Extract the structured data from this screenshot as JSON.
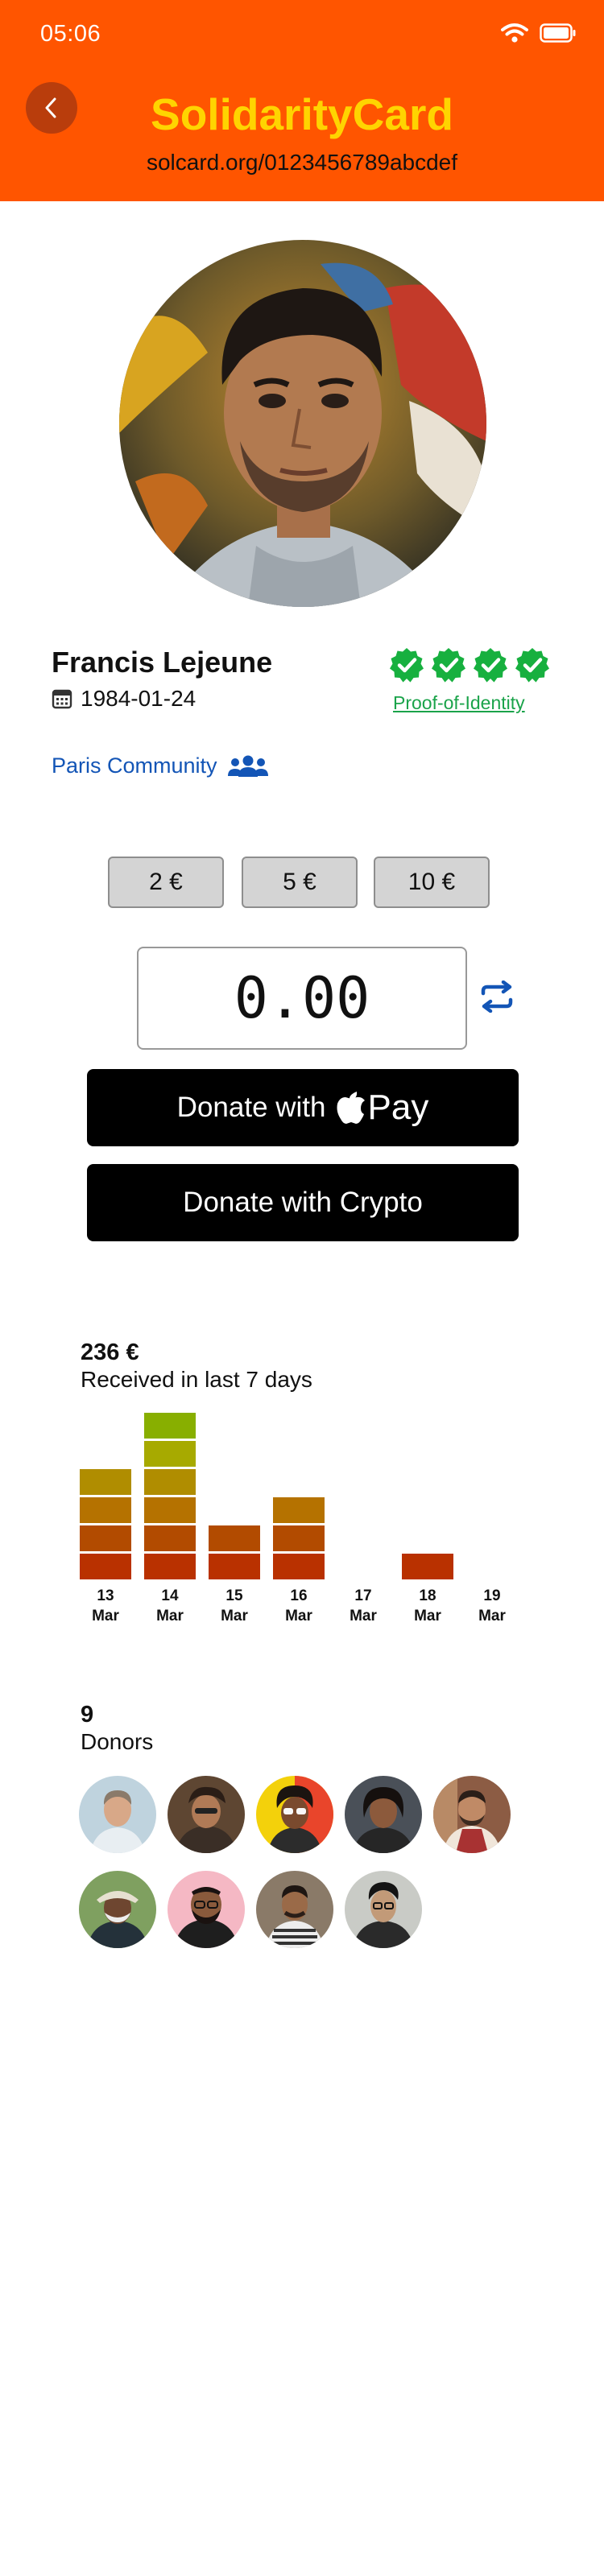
{
  "status_bar": {
    "time": "05:06",
    "wifi_icon": "wifi-icon",
    "battery_icon": "battery-icon"
  },
  "header": {
    "title": "SolidarityCard",
    "url": "solcard.org/0123456789abcdef",
    "background": "#FF5500",
    "title_color": "#FFD400",
    "back_icon": "chevron-left-icon"
  },
  "profile": {
    "name": "Francis Lejeune",
    "dob": "1984-01-24",
    "proof_label": "Proof-of-Identity",
    "verified_badges": 4,
    "community": "Paris Community"
  },
  "donation": {
    "presets": [
      "2 €",
      "5 €",
      "10 €"
    ],
    "amount": "0.00",
    "apple_pay_prefix": "Donate with",
    "apple_pay_brand": "Pay",
    "crypto_label": "Donate with Crypto"
  },
  "stats": {
    "total": "236 €",
    "total_label": "Received in last 7 days",
    "days": [
      {
        "day": "13",
        "month": "Mar"
      },
      {
        "day": "14",
        "month": "Mar"
      },
      {
        "day": "15",
        "month": "Mar"
      },
      {
        "day": "16",
        "month": "Mar"
      },
      {
        "day": "17",
        "month": "Mar"
      },
      {
        "day": "18",
        "month": "Mar"
      },
      {
        "day": "19",
        "month": "Mar"
      }
    ]
  },
  "chart_data": {
    "type": "bar",
    "categories": [
      "13 Mar",
      "14 Mar",
      "15 Mar",
      "16 Mar",
      "17 Mar",
      "18 Mar",
      "19 Mar"
    ],
    "values": [
      4,
      6,
      2,
      3,
      0,
      1,
      0
    ],
    "segment_colors": [
      "#B93100",
      "#B24B00",
      "#B57200",
      "#B08D00",
      "#A7AA00",
      "#88AF00",
      "#5CB000"
    ],
    "xlabel": "",
    "ylabel": ""
  },
  "donors": {
    "count": "9",
    "label": "Donors",
    "avatars": [
      "donor-avatar-1",
      "donor-avatar-2",
      "donor-avatar-3",
      "donor-avatar-4",
      "donor-avatar-5",
      "donor-avatar-6",
      "donor-avatar-7",
      "donor-avatar-8",
      "donor-avatar-9"
    ]
  }
}
